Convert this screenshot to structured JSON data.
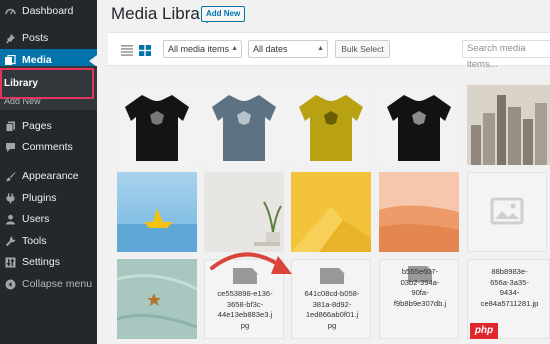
{
  "sidebar": {
    "items": [
      {
        "label": "Dashboard",
        "icon": "dashboard-icon"
      },
      {
        "label": "Posts",
        "icon": "pin-icon"
      },
      {
        "label": "Media",
        "icon": "media-icon"
      },
      {
        "label": "Pages",
        "icon": "pages-icon"
      },
      {
        "label": "Comments",
        "icon": "comments-icon"
      },
      {
        "label": "Appearance",
        "icon": "brush-icon"
      },
      {
        "label": "Plugins",
        "icon": "plug-icon"
      },
      {
        "label": "Users",
        "icon": "user-icon"
      },
      {
        "label": "Tools",
        "icon": "wrench-icon"
      },
      {
        "label": "Settings",
        "icon": "settings-icon"
      },
      {
        "label": "Collapse menu",
        "icon": "collapse-icon"
      }
    ],
    "submenu": {
      "library": "Library",
      "add_new": "Add New"
    }
  },
  "header": {
    "title": "Media Library",
    "add_new": "Add New"
  },
  "toolbar": {
    "type_filter": "All media items",
    "date_filter": "All dates",
    "bulk_select": "Bulk Select",
    "search_placeholder": "Search media items..."
  },
  "media": {
    "files": [
      {
        "name": "ce553898-e136-3658-bf3c-44e13eb883e3.jpg",
        "lines": [
          "ce553898-e136-",
          "3658-bf3c-",
          "44e13eb883e3.j",
          "pg"
        ]
      },
      {
        "name": "641c08cd-b058-381a-8d92-1ed866ab0f01.jpg",
        "lines": [
          "641c08cd-b058-",
          "381a-8d92-",
          "1ed866ab0f01.j",
          "pg"
        ]
      },
      {
        "name": "b555e607-03b2-394a-90fa-f9b8b9e307db.jpg",
        "lines": [
          "b555e607-",
          "03b2-394a-",
          "90fa-",
          "f9b8b9e307db.j"
        ]
      },
      {
        "name": "88b8983e-656a-3a35-9434-ce84a5711281.jpg",
        "lines": [
          "88b8983e-",
          "656a-3a35-",
          "9434-",
          "ce84a5711281.jp"
        ]
      }
    ],
    "tshirt_colors": [
      "#141414",
      "#5d7383",
      "#b8a113",
      "#121212"
    ]
  },
  "watermark": "php",
  "colors": {
    "accent": "#0073aa",
    "highlight": "#e2345e",
    "sidebar": "#23282d"
  }
}
